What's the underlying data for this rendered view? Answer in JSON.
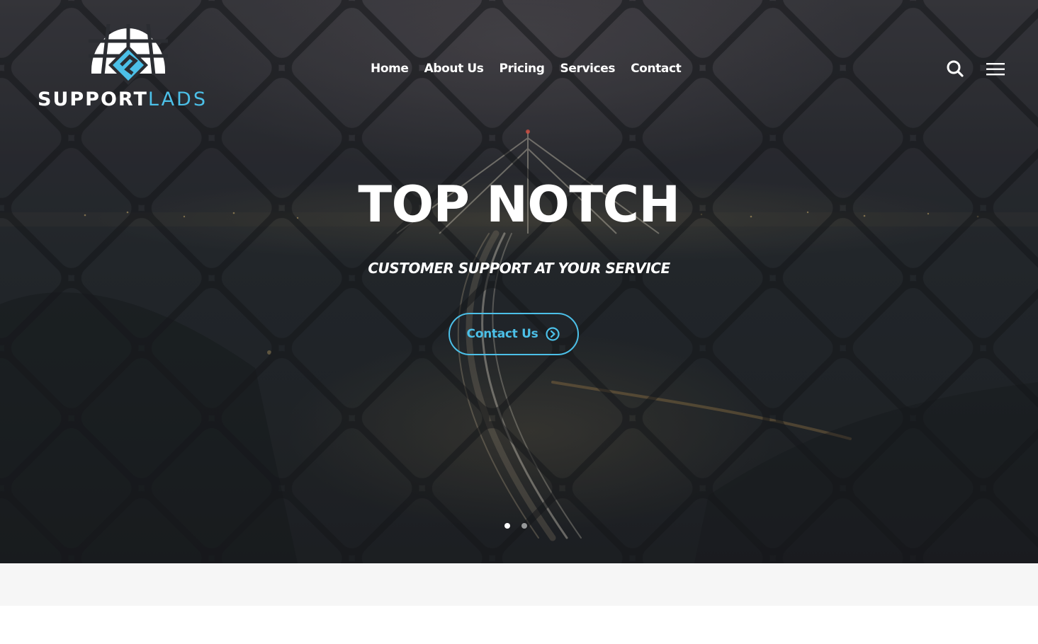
{
  "brand": {
    "name_primary": "SUPPORT",
    "name_secondary": "LADS",
    "accent_color": "#4cc0e8",
    "logo_icon": "globe-grid-logo-icon"
  },
  "nav": {
    "items": [
      {
        "label": "Home"
      },
      {
        "label": "About Us"
      },
      {
        "label": "Pricing"
      },
      {
        "label": "Services"
      },
      {
        "label": "Contact"
      }
    ]
  },
  "header_icons": {
    "search": "search-icon",
    "menu": "hamburger-menu-icon"
  },
  "hero": {
    "title": "TOP NOTCH",
    "subtitle": "CUSTOMER SUPPORT AT YOUR SERVICE",
    "cta_label": "Contact Us",
    "cta_icon": "circle-chevron-right-icon",
    "background_image": "night-city-bridge-through-chain-link-fence",
    "slides_count": 2,
    "active_slide": 1
  },
  "colors": {
    "accent": "#4cc0e8",
    "text": "#ffffff",
    "band": "#f6f6f6"
  }
}
